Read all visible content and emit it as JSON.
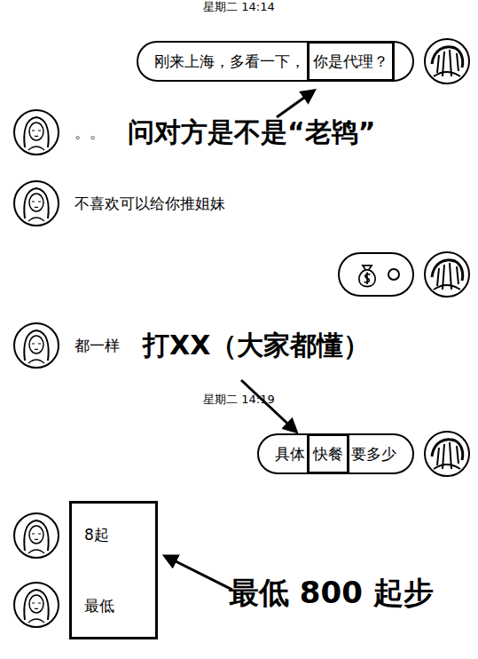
{
  "chat": [
    {
      "kind": "time",
      "text": "星期二 14:14"
    },
    {
      "kind": "message",
      "side": "right",
      "segments": [
        {
          "text": "刚来上海，多看一下，",
          "highlighted": false
        },
        {
          "text": "你是代理？",
          "highlighted": true
        }
      ]
    },
    {
      "kind": "message",
      "side": "left",
      "segments": [
        {
          "text": "。。",
          "highlighted": false
        }
      ],
      "note": "问对方是不是“老鸨”"
    },
    {
      "kind": "message",
      "side": "left",
      "segments": [
        {
          "text": "不喜欢可以给你推姐妹",
          "highlighted": false
        }
      ]
    },
    {
      "kind": "sticker",
      "side": "right"
    },
    {
      "kind": "message",
      "side": "left",
      "segments": [
        {
          "text": "都一样",
          "highlighted": false
        }
      ],
      "note": "打XX（大家都懂）"
    },
    {
      "kind": "time",
      "text": "星期二 14:19"
    },
    {
      "kind": "message",
      "side": "right",
      "segments": [
        {
          "text": "具体",
          "highlighted": false
        },
        {
          "text": "快餐",
          "highlighted": true
        },
        {
          "text": "要多少",
          "highlighted": false
        }
      ]
    },
    {
      "kind": "group",
      "side": "left",
      "boxed": true,
      "messages": [
        "8起",
        "最低"
      ],
      "note": "最低 800 起步"
    }
  ]
}
